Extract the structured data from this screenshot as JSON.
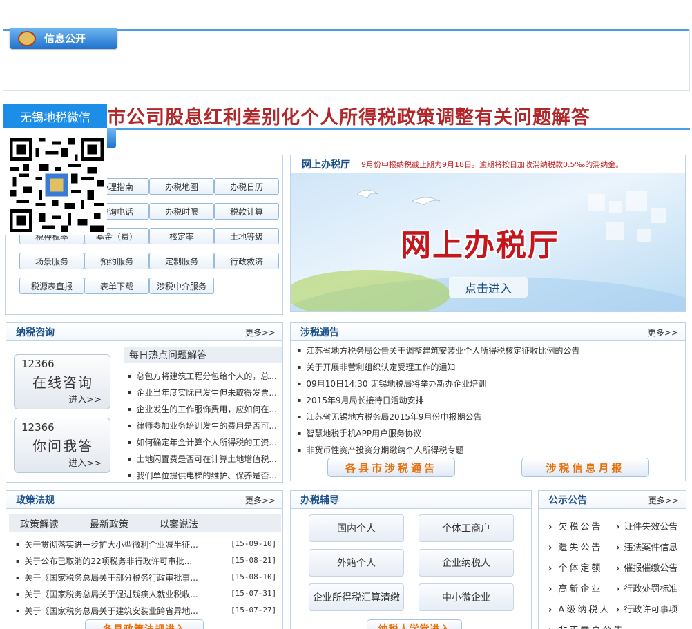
{
  "info_tab": "信息公开",
  "headline": "市公司股息红利差别化个人所得税政策调整有关问题解答",
  "wechat": {
    "title": "无锡地税微信"
  },
  "service_buttons": [
    "办理指南",
    "办税地图",
    "办税日历",
    "咨询电话",
    "办税时限",
    "税款计算",
    "税种税率",
    "基金（费）",
    "核定率",
    "土地等级",
    "场景服务",
    "预约服务",
    "定制服务",
    "行政救济",
    "税源表直报",
    "表单下载",
    "涉税中介服务"
  ],
  "online_hall": {
    "title": "网上办税厅",
    "notice": "9月份申报纳税截止期为9月18日。逾期将按日加收滞纳税款0.5‰的滞纳金。",
    "banner_title": "网上办税厅",
    "enter": "点击进入"
  },
  "consult": {
    "title": "纳税咨询",
    "more": "更多>>",
    "hot_title": "每日热点问题解答",
    "card1": {
      "num": "12366",
      "name": "在线咨询",
      "enter": "进入>>"
    },
    "card2": {
      "num": "12366",
      "name": "你问我答",
      "enter": "进入>>"
    },
    "items": [
      "总包方将建筑工程分包给个人的，总...",
      "企业当年度实际已发生但未取得发票...",
      "企业发生的工作服饰费用，应如何在...",
      "律师参加业务培训发生的费用是否可...",
      "如何确定年金计算个人所得税的工资...",
      "土地闲置费是否可在计算土地增值税...",
      "我们单位提供电梯的维护、保养是否..."
    ]
  },
  "tax_notice": {
    "title": "涉税通告",
    "more": "更多>>",
    "items": [
      "江苏省地方税务局公告关于调整建筑安装业个人所得税核定征收比例的公告",
      "关于开展非营利组织认定受理工作的通知",
      "09月10日14:30 无锡地税局将举办新办企业培训",
      "2015年9月局长接待日活动安排",
      "江苏省无锡地方税务局2015年9月份申报期公告",
      "智慧地税手机APP用户服务协议",
      "非货币性资产投资分期缴纳个人所得税专题"
    ],
    "btn_county": "各县市涉税通告",
    "btn_monthly": "涉税信息月报"
  },
  "policy": {
    "title": "政策法规",
    "more": "更多>>",
    "tabs": [
      "政策解读",
      "最新政策",
      "以案说法"
    ],
    "items": [
      {
        "text": "关于贯彻落实进一步扩大小型微利企业减半征...",
        "date": "[15-09-10]"
      },
      {
        "text": "关于公布已取消的22项税务非行政许可审批...",
        "date": "[15-08-21]"
      },
      {
        "text": "关于《国家税务总局关于部分税务行政审批事...",
        "date": "[15-08-10]"
      },
      {
        "text": "关于《国家税务总局关于促进残疾人就业税收...",
        "date": "[15-07-31]"
      },
      {
        "text": "关于《国家税务总局关于建筑安装业跨省异地...",
        "date": "[15-07-27]"
      }
    ],
    "bottom_btn": "各县政策法规进入"
  },
  "guide": {
    "title": "办税辅导",
    "buttons": [
      "国内个人",
      "个体工商户",
      "外籍个人",
      "企业纳税人",
      "企业所得税汇算清缴",
      "中小微企业"
    ],
    "bottom_btn": "纳税人学堂进入"
  },
  "public_notice": {
    "title": "公示公告",
    "more": "更多>>",
    "left": [
      "欠税公告",
      "遗失公告",
      "个体定额",
      "高新企业",
      "A级纳税人",
      "非正常户公告"
    ],
    "right": [
      "证件失效公告",
      "违法案件信息",
      "催报催缴公告",
      "行政处罚标准",
      "行政许可事项"
    ]
  },
  "colors": {
    "accent": "#1f72cc",
    "headline": "#b2272a",
    "orange": "#e8710b"
  }
}
